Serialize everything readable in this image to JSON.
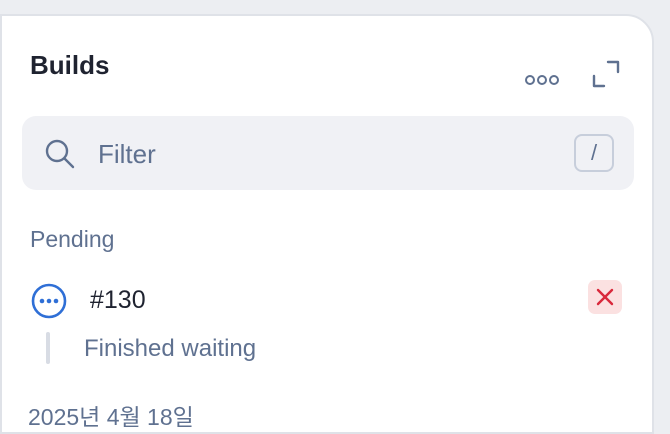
{
  "header": {
    "title": "Builds"
  },
  "filter": {
    "placeholder": "Filter",
    "shortcut": "/"
  },
  "sections": [
    {
      "label": "Pending",
      "builds": [
        {
          "number": "#130",
          "status_icon": "pending-dots-icon",
          "step": "Finished waiting",
          "action_icon": "close-icon"
        }
      ]
    },
    {
      "label": "2025년 4월 18일"
    }
  ],
  "colors": {
    "accent": "#2f6fd6",
    "danger": "#d9293b",
    "danger_bg": "#fbe1e1",
    "muted_text": "#5f7190"
  }
}
